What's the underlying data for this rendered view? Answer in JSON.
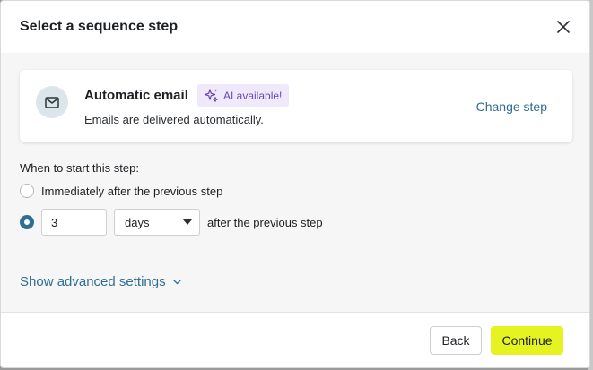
{
  "modal": {
    "title": "Select a sequence step"
  },
  "step_card": {
    "title": "Automatic email",
    "badge": "AI available!",
    "description": "Emails are delivered automatically.",
    "change_label": "Change step"
  },
  "timing": {
    "label": "When to start this step:",
    "option_immediate": "Immediately after the previous step",
    "delay_value": "3",
    "delay_unit": "days",
    "after_label": "after the previous step",
    "selected": "delay"
  },
  "advanced": {
    "label": "Show advanced settings"
  },
  "footer": {
    "back_label": "Back",
    "continue_label": "Continue"
  },
  "colors": {
    "accent": "#2f6e93",
    "primary_button": "#e5f420",
    "ai_badge_bg": "#efe9fb",
    "ai_badge_text": "#6a47b8"
  },
  "icons": {
    "close": "close-icon",
    "email": "mail-icon",
    "ai": "sparkle-icon",
    "dropdown": "chevron-down-icon"
  }
}
